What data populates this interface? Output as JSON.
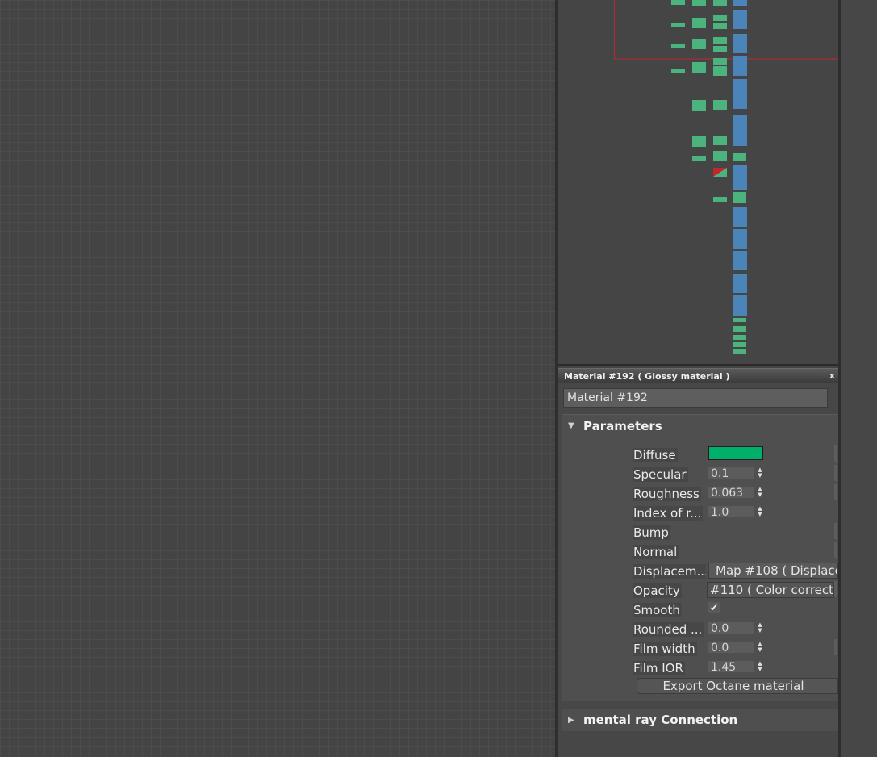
{
  "panel": {
    "title": "Material #192  ( Glossy material )",
    "close_label": "x",
    "name_value": "Material #192"
  },
  "parameters": {
    "title": "Parameters",
    "arrow": "▼",
    "diffuse": {
      "label": "Diffuse",
      "color": "#00b06a"
    },
    "specular": {
      "label": "Specular",
      "value": "0.1"
    },
    "roughness": {
      "label": "Roughness",
      "value": "0.063"
    },
    "ior": {
      "label": "Index of r...",
      "value": "1.0"
    },
    "bump": {
      "label": "Bump"
    },
    "normal": {
      "label": "Normal"
    },
    "displacement": {
      "label": "Displacem...",
      "map": "Map #108  ( Displace"
    },
    "opacity": {
      "label": "Opacity",
      "map": "#110  ( Color correct"
    },
    "smooth": {
      "label": "Smooth",
      "checked": "✔"
    },
    "rounded": {
      "label": "Rounded ...",
      "value": "0.0"
    },
    "film_width": {
      "label": "Film width",
      "value": "0.0"
    },
    "film_ior": {
      "label": "Film IOR",
      "value": "1.45"
    },
    "export_label": "Export Octane material",
    "spin_glyph": "▲▼"
  },
  "mental_ray": {
    "title": "mental ray Connection",
    "arrow": "▶"
  },
  "colors": {
    "node_green": "#4db37e",
    "node_blue": "#4a84b8",
    "selection_red": "#c0282e",
    "canvas_bg": "#444444"
  }
}
